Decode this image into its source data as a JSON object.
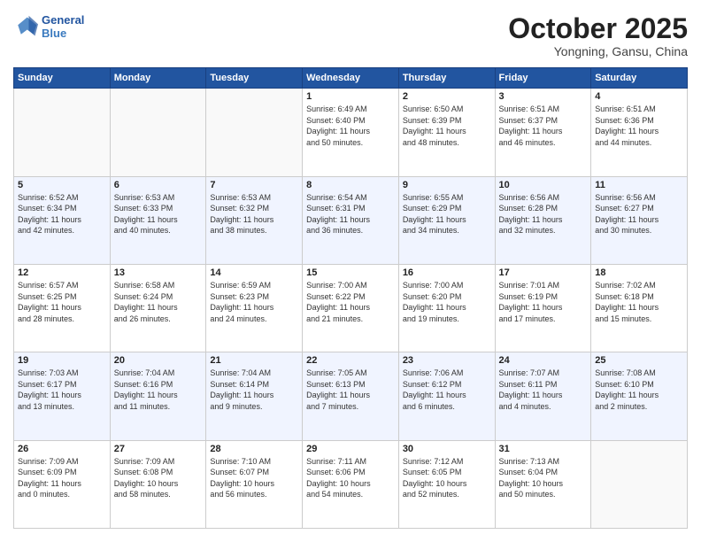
{
  "logo": {
    "line1": "General",
    "line2": "Blue"
  },
  "title": "October 2025",
  "location": "Yongning, Gansu, China",
  "weekdays": [
    "Sunday",
    "Monday",
    "Tuesday",
    "Wednesday",
    "Thursday",
    "Friday",
    "Saturday"
  ],
  "weeks": [
    [
      {
        "day": "",
        "info": ""
      },
      {
        "day": "",
        "info": ""
      },
      {
        "day": "",
        "info": ""
      },
      {
        "day": "1",
        "info": "Sunrise: 6:49 AM\nSunset: 6:40 PM\nDaylight: 11 hours\nand 50 minutes."
      },
      {
        "day": "2",
        "info": "Sunrise: 6:50 AM\nSunset: 6:39 PM\nDaylight: 11 hours\nand 48 minutes."
      },
      {
        "day": "3",
        "info": "Sunrise: 6:51 AM\nSunset: 6:37 PM\nDaylight: 11 hours\nand 46 minutes."
      },
      {
        "day": "4",
        "info": "Sunrise: 6:51 AM\nSunset: 6:36 PM\nDaylight: 11 hours\nand 44 minutes."
      }
    ],
    [
      {
        "day": "5",
        "info": "Sunrise: 6:52 AM\nSunset: 6:34 PM\nDaylight: 11 hours\nand 42 minutes."
      },
      {
        "day": "6",
        "info": "Sunrise: 6:53 AM\nSunset: 6:33 PM\nDaylight: 11 hours\nand 40 minutes."
      },
      {
        "day": "7",
        "info": "Sunrise: 6:53 AM\nSunset: 6:32 PM\nDaylight: 11 hours\nand 38 minutes."
      },
      {
        "day": "8",
        "info": "Sunrise: 6:54 AM\nSunset: 6:31 PM\nDaylight: 11 hours\nand 36 minutes."
      },
      {
        "day": "9",
        "info": "Sunrise: 6:55 AM\nSunset: 6:29 PM\nDaylight: 11 hours\nand 34 minutes."
      },
      {
        "day": "10",
        "info": "Sunrise: 6:56 AM\nSunset: 6:28 PM\nDaylight: 11 hours\nand 32 minutes."
      },
      {
        "day": "11",
        "info": "Sunrise: 6:56 AM\nSunset: 6:27 PM\nDaylight: 11 hours\nand 30 minutes."
      }
    ],
    [
      {
        "day": "12",
        "info": "Sunrise: 6:57 AM\nSunset: 6:25 PM\nDaylight: 11 hours\nand 28 minutes."
      },
      {
        "day": "13",
        "info": "Sunrise: 6:58 AM\nSunset: 6:24 PM\nDaylight: 11 hours\nand 26 minutes."
      },
      {
        "day": "14",
        "info": "Sunrise: 6:59 AM\nSunset: 6:23 PM\nDaylight: 11 hours\nand 24 minutes."
      },
      {
        "day": "15",
        "info": "Sunrise: 7:00 AM\nSunset: 6:22 PM\nDaylight: 11 hours\nand 21 minutes."
      },
      {
        "day": "16",
        "info": "Sunrise: 7:00 AM\nSunset: 6:20 PM\nDaylight: 11 hours\nand 19 minutes."
      },
      {
        "day": "17",
        "info": "Sunrise: 7:01 AM\nSunset: 6:19 PM\nDaylight: 11 hours\nand 17 minutes."
      },
      {
        "day": "18",
        "info": "Sunrise: 7:02 AM\nSunset: 6:18 PM\nDaylight: 11 hours\nand 15 minutes."
      }
    ],
    [
      {
        "day": "19",
        "info": "Sunrise: 7:03 AM\nSunset: 6:17 PM\nDaylight: 11 hours\nand 13 minutes."
      },
      {
        "day": "20",
        "info": "Sunrise: 7:04 AM\nSunset: 6:16 PM\nDaylight: 11 hours\nand 11 minutes."
      },
      {
        "day": "21",
        "info": "Sunrise: 7:04 AM\nSunset: 6:14 PM\nDaylight: 11 hours\nand 9 minutes."
      },
      {
        "day": "22",
        "info": "Sunrise: 7:05 AM\nSunset: 6:13 PM\nDaylight: 11 hours\nand 7 minutes."
      },
      {
        "day": "23",
        "info": "Sunrise: 7:06 AM\nSunset: 6:12 PM\nDaylight: 11 hours\nand 6 minutes."
      },
      {
        "day": "24",
        "info": "Sunrise: 7:07 AM\nSunset: 6:11 PM\nDaylight: 11 hours\nand 4 minutes."
      },
      {
        "day": "25",
        "info": "Sunrise: 7:08 AM\nSunset: 6:10 PM\nDaylight: 11 hours\nand 2 minutes."
      }
    ],
    [
      {
        "day": "26",
        "info": "Sunrise: 7:09 AM\nSunset: 6:09 PM\nDaylight: 11 hours\nand 0 minutes."
      },
      {
        "day": "27",
        "info": "Sunrise: 7:09 AM\nSunset: 6:08 PM\nDaylight: 10 hours\nand 58 minutes."
      },
      {
        "day": "28",
        "info": "Sunrise: 7:10 AM\nSunset: 6:07 PM\nDaylight: 10 hours\nand 56 minutes."
      },
      {
        "day": "29",
        "info": "Sunrise: 7:11 AM\nSunset: 6:06 PM\nDaylight: 10 hours\nand 54 minutes."
      },
      {
        "day": "30",
        "info": "Sunrise: 7:12 AM\nSunset: 6:05 PM\nDaylight: 10 hours\nand 52 minutes."
      },
      {
        "day": "31",
        "info": "Sunrise: 7:13 AM\nSunset: 6:04 PM\nDaylight: 10 hours\nand 50 minutes."
      },
      {
        "day": "",
        "info": ""
      }
    ]
  ]
}
